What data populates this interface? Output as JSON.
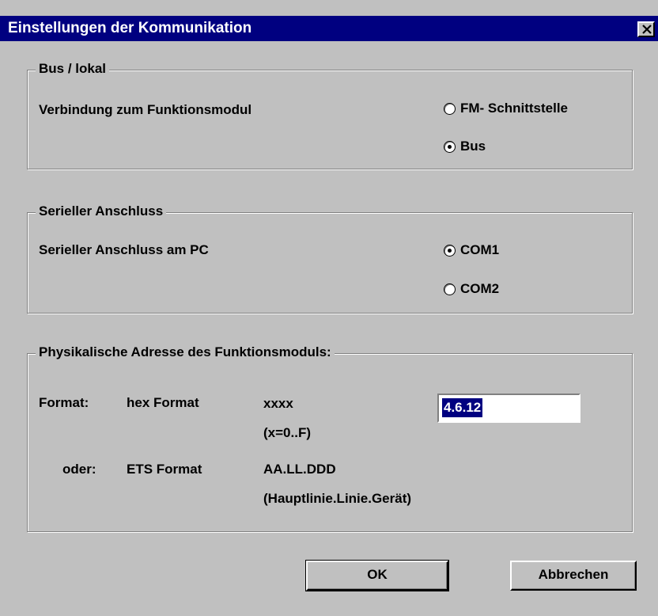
{
  "window": {
    "title": "Einstellungen der Kommunikation",
    "close_label": "✕"
  },
  "bus_group": {
    "legend": "Bus / lokal",
    "label": "Verbindung zum Funktionsmodul",
    "options": [
      {
        "label": "FM- Schnittstelle",
        "selected": false
      },
      {
        "label": "Bus",
        "selected": true
      }
    ]
  },
  "serial_group": {
    "legend": "Serieller Anschluss",
    "label": "Serieller Anschluss am PC",
    "options": [
      {
        "label": "COM1",
        "selected": true
      },
      {
        "label": "COM2",
        "selected": false
      }
    ]
  },
  "address_group": {
    "legend": "Physikalische Adresse des Funktionsmoduls:",
    "format_label": "Format:",
    "hex_format": "hex Format",
    "hex_pattern": "xxxx",
    "hex_range": "(x=0..F)",
    "or_label": "oder:",
    "ets_format": "ETS Format",
    "ets_pattern": "AA.LL.DDD",
    "ets_desc": "(Hauptlinie.Linie.Gerät)",
    "address_value": "4.6.12"
  },
  "buttons": {
    "ok": "OK",
    "cancel": "Abbrechen"
  }
}
